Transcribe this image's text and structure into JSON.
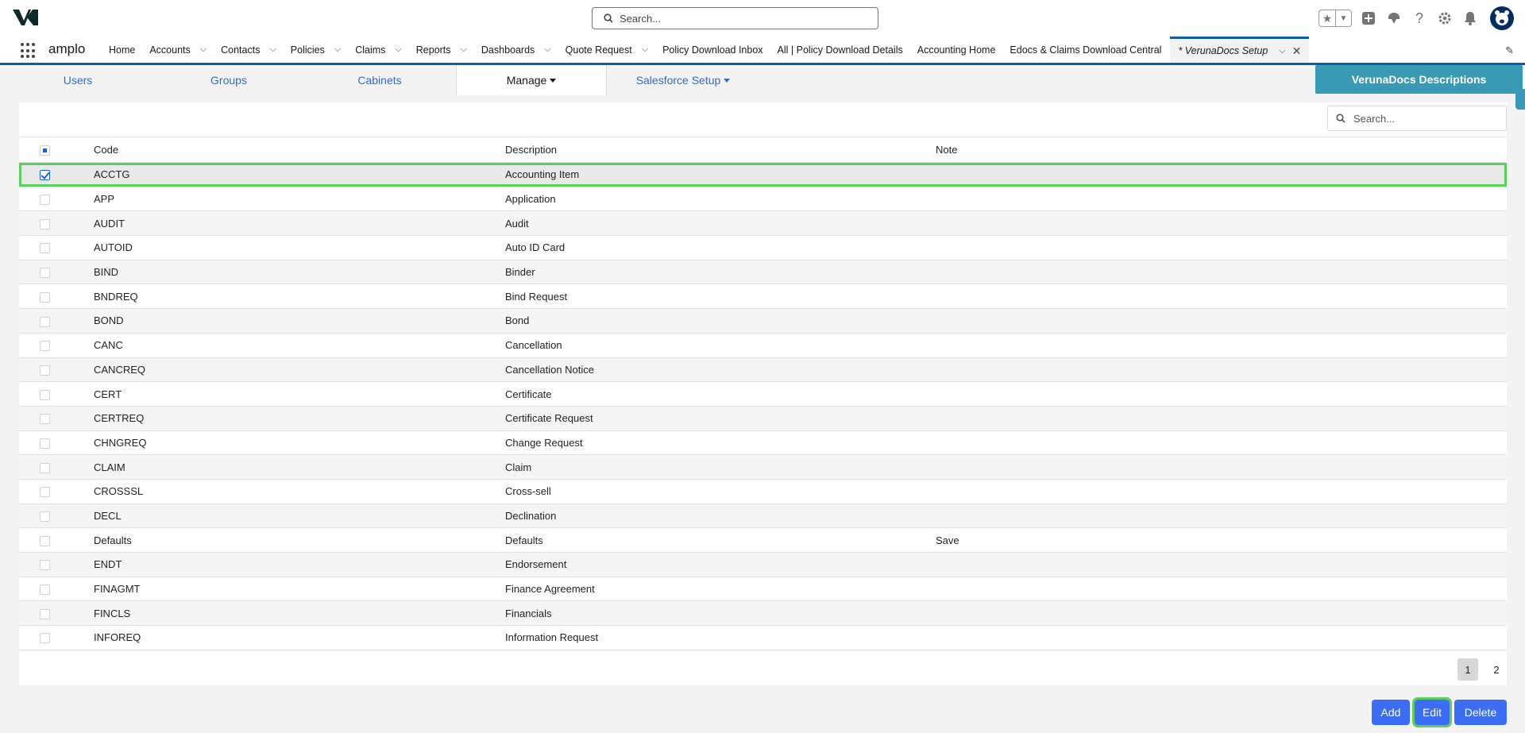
{
  "header": {
    "search_placeholder": "Search...",
    "brand_color": "#032d60"
  },
  "nav": {
    "app_name": "amplo",
    "items": [
      {
        "label": "Home",
        "has_menu": false
      },
      {
        "label": "Accounts",
        "has_menu": true
      },
      {
        "label": "Contacts",
        "has_menu": true
      },
      {
        "label": "Policies",
        "has_menu": true
      },
      {
        "label": "Claims",
        "has_menu": true
      },
      {
        "label": "Reports",
        "has_menu": true
      },
      {
        "label": "Dashboards",
        "has_menu": true
      },
      {
        "label": "Quote Request",
        "has_menu": true
      },
      {
        "label": "Policy Download Inbox",
        "has_menu": false
      },
      {
        "label": "All | Policy Download Details",
        "has_menu": false
      },
      {
        "label": "Accounting Home",
        "has_menu": false
      },
      {
        "label": "Edocs & Claims Download Central",
        "has_menu": false
      }
    ],
    "active_tab": "* VerunaDocs Setup"
  },
  "tabs": {
    "users": "Users",
    "groups": "Groups",
    "cabinets": "Cabinets",
    "manage": "Manage",
    "salesforce_setup": "Salesforce Setup",
    "right_panel": "VerunaDocs Descriptions"
  },
  "grid": {
    "search_placeholder": "Search...",
    "columns": {
      "code": "Code",
      "description": "Description",
      "note": "Note"
    },
    "rows": [
      {
        "code": "ACCTG",
        "description": "Accounting Item",
        "note": "",
        "checked": true
      },
      {
        "code": "APP",
        "description": "Application",
        "note": "",
        "checked": false
      },
      {
        "code": "AUDIT",
        "description": "Audit",
        "note": "",
        "checked": false
      },
      {
        "code": "AUTOID",
        "description": "Auto ID Card",
        "note": "",
        "checked": false
      },
      {
        "code": "BIND",
        "description": "Binder",
        "note": "",
        "checked": false
      },
      {
        "code": "BNDREQ",
        "description": "Bind Request",
        "note": "",
        "checked": false
      },
      {
        "code": "BOND",
        "description": "Bond",
        "note": "",
        "checked": false
      },
      {
        "code": "CANC",
        "description": "Cancellation",
        "note": "",
        "checked": false
      },
      {
        "code": "CANCREQ",
        "description": "Cancellation Notice",
        "note": "",
        "checked": false
      },
      {
        "code": "CERT",
        "description": "Certificate",
        "note": "",
        "checked": false
      },
      {
        "code": "CERTREQ",
        "description": "Certificate Request",
        "note": "",
        "checked": false
      },
      {
        "code": "CHNGREQ",
        "description": "Change Request",
        "note": "",
        "checked": false
      },
      {
        "code": "CLAIM",
        "description": "Claim",
        "note": "",
        "checked": false
      },
      {
        "code": "CROSSSL",
        "description": "Cross-sell",
        "note": "",
        "checked": false
      },
      {
        "code": "DECL",
        "description": "Declination",
        "note": "",
        "checked": false
      },
      {
        "code": "Defaults",
        "description": "Defaults",
        "note": "Save",
        "checked": false
      },
      {
        "code": "ENDT",
        "description": "Endorsement",
        "note": "",
        "checked": false
      },
      {
        "code": "FINAGMT",
        "description": "Finance Agreement",
        "note": "",
        "checked": false
      },
      {
        "code": "FINCLS",
        "description": "Financials",
        "note": "",
        "checked": false
      },
      {
        "code": "INFOREQ",
        "description": "Information Request",
        "note": "",
        "checked": false
      }
    ],
    "pages": [
      "1",
      "2"
    ],
    "current_page": "1"
  },
  "actions": {
    "add": "Add",
    "edit": "Edit",
    "delete": "Delete"
  },
  "colors": {
    "accent_teal": "#3a9ab5",
    "button_blue": "#3b6ef5",
    "highlight_green": "#5ecf5e"
  }
}
